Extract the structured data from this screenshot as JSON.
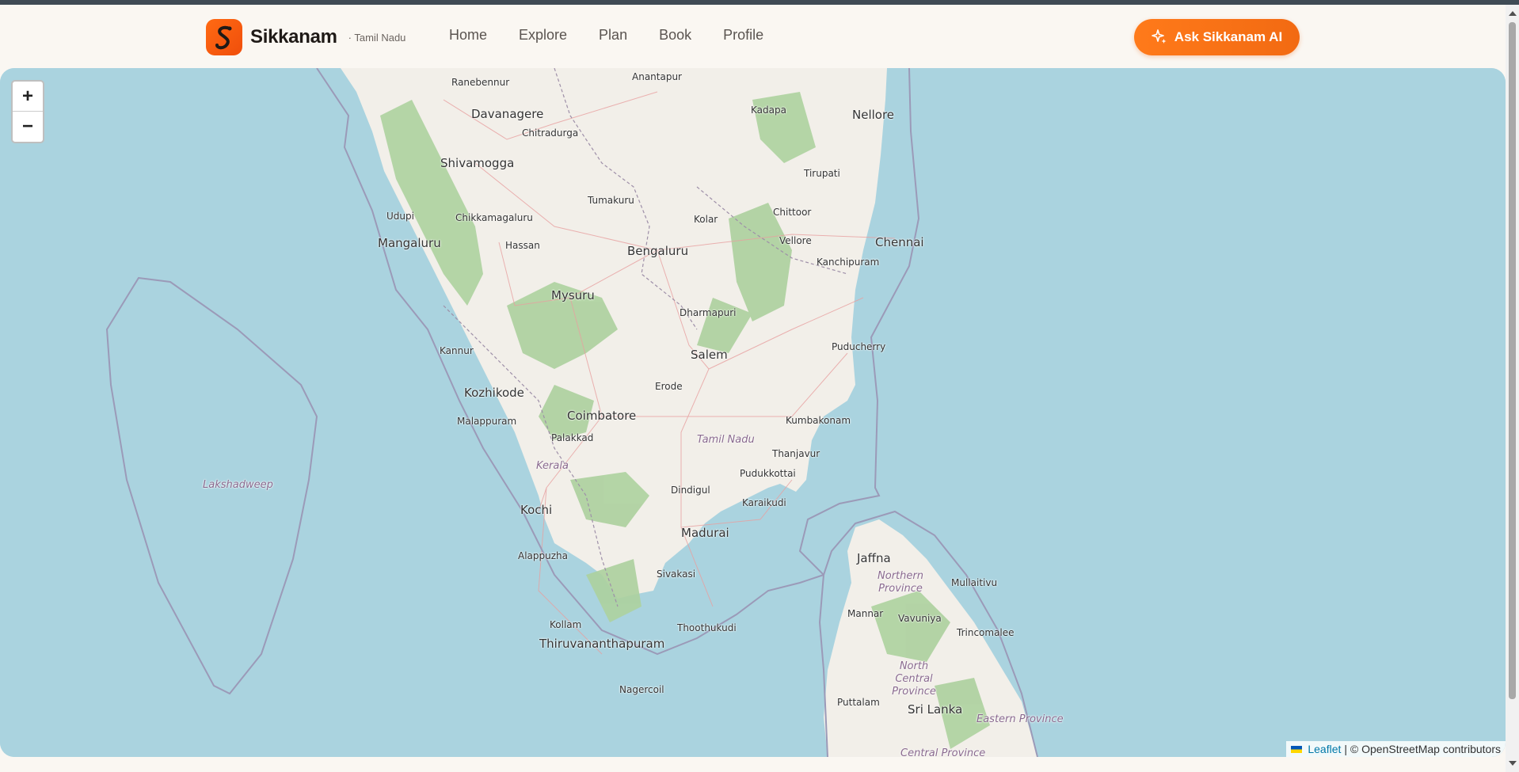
{
  "brand": {
    "name": "Sikkanam",
    "region": "· Tamil Nadu",
    "accent": "#f26a12"
  },
  "nav": {
    "items": [
      "Home",
      "Explore",
      "Plan",
      "Book",
      "Profile"
    ]
  },
  "ai_button": {
    "label": "Ask Sikkanam AI",
    "icon": "sparkle-icon"
  },
  "map": {
    "zoom_in": "+",
    "zoom_out": "−",
    "attribution": {
      "leaflet": "Leaflet",
      "rest": "| © OpenStreetMap contributors"
    },
    "labels": {
      "anantapur": "Anantapur",
      "ranebennur": "Ranebennur",
      "davanagere": "Davanagere",
      "kadapa": "Kadapa",
      "nellore": "Nellore",
      "chitradurga": "Chitradurga",
      "shivamogga": "Shivamogga",
      "tirupati": "Tirupati",
      "tumakuru": "Tumakuru",
      "udupi": "Udupi",
      "chikkamagaluru": "Chikkamagaluru",
      "chittoor": "Chittoor",
      "kolar": "Kolar",
      "mangaluru": "Mangaluru",
      "hassan": "Hassan",
      "bengaluru": "Bengaluru",
      "vellore": "Vellore",
      "chennai": "Chennai",
      "kanchipuram": "Kanchipuram",
      "mysuru": "Mysuru",
      "dharmapuri": "Dharmapuri",
      "puducherry": "Puducherry",
      "kannur": "Kannur",
      "salem": "Salem",
      "kozhikode": "Kozhikode",
      "erode": "Erode",
      "malappuram": "Malappuram",
      "coimbatore": "Coimbatore",
      "kumbakonam": "Kumbakonam",
      "palakkad": "Palakkad",
      "tamilnadu": "Tamil Nadu",
      "thanjavur": "Thanjavur",
      "kerala": "Kerala",
      "pudukkottai": "Pudukkottai",
      "lakshadweep": "Lakshadweep",
      "dindigul": "Dindigul",
      "karaikudi": "Karaikudi",
      "kochi": "Kochi",
      "madurai": "Madurai",
      "jaffna": "Jaffna",
      "alappuzha": "Alappuzha",
      "northernprovince": "Northern Province",
      "mullaitivu": "Mullaitivu",
      "sivakasi": "Sivakasi",
      "mannar": "Mannar",
      "vavuniya": "Vavuniya",
      "kollam": "Kollam",
      "thoothukudi": "Thoothukudi",
      "trincomalee": "Trincomalee",
      "thiruvananthapuram": "Thiruvananthapuram",
      "northcentral": "North Central Province",
      "puttalam": "Puttalam",
      "nagercoil": "Nagercoil",
      "srilanka": "Sri Lanka",
      "eastern": "Eastern Province",
      "central": "Central Province"
    }
  }
}
